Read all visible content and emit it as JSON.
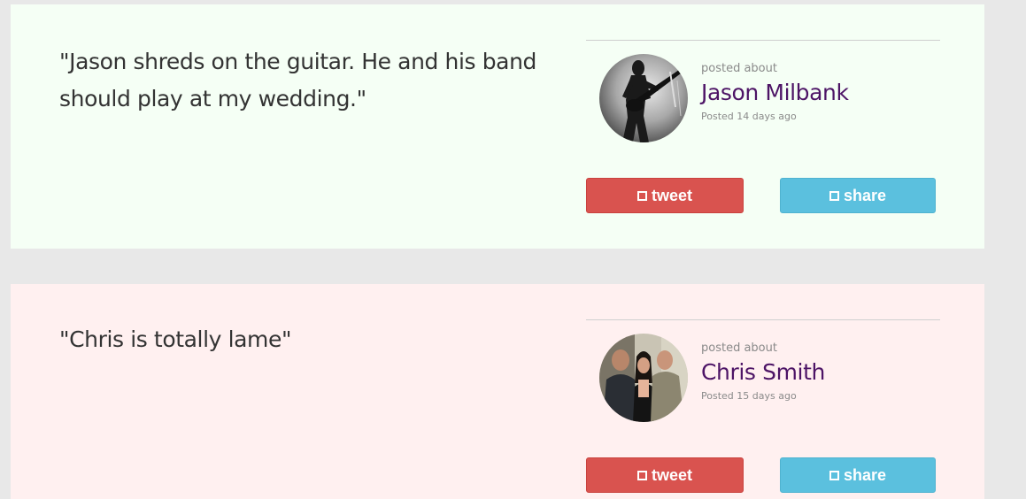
{
  "posts": [
    {
      "quote": "\"Jason shreds on the guitar. He and his band should play at my wedding.\"",
      "posted_about_label": "posted about",
      "author_name": "Jason Milbank",
      "posted_time": "Posted 14 days ago",
      "tweet_label": "tweet",
      "share_label": "share",
      "avatar_icon": "guitarist-silhouette-photo",
      "background_color": "#f5fff5"
    },
    {
      "quote": "\"Chris is totally lame\"",
      "posted_about_label": "posted about",
      "author_name": "Chris Smith",
      "posted_time": "Posted 15 days ago",
      "tweet_label": "tweet",
      "share_label": "share",
      "avatar_icon": "group-photo",
      "background_color": "#fff0f0"
    }
  ],
  "colors": {
    "tweet_button": "#d9534f",
    "share_button": "#5bc0de",
    "author_link": "#4d1466",
    "page_background": "#e8e8e8"
  },
  "icons": {
    "button_icon": "square-icon"
  }
}
